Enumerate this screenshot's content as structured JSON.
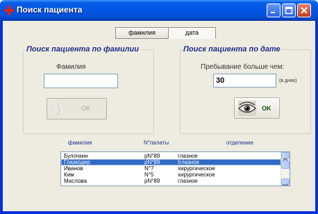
{
  "window": {
    "title": "Поиск пациента"
  },
  "tabs": [
    {
      "label": "фамилия"
    },
    {
      "label": "дата"
    }
  ],
  "by_surname": {
    "legend": "Поиск пациента по фамилии",
    "field_label": "Фамилия",
    "field_value": "",
    "ok_label": "OK"
  },
  "by_date": {
    "legend": "Поиск пациента по дате",
    "field_label": "Пребывание больше чем:",
    "days_value": "30",
    "unit_label": "(в днях)",
    "ok_label": "OK"
  },
  "columns": {
    "surname": "фамилия",
    "ward": "N°палаты",
    "department": "отделение"
  },
  "patients": [
    {
      "surname": "Булочкин",
      "ward": "pN°89",
      "department": "глазное"
    },
    {
      "surname": "Глазкодер",
      "ward": "pN°89",
      "department": "Iглазное",
      "selected": true
    },
    {
      "surname": "Иванов",
      "ward": "N°7",
      "department": "хирургическое"
    },
    {
      "surname": "Ким",
      "ward": "N°5",
      "department": "хирургическое"
    },
    {
      "surname": "Маслова",
      "ward": "pN°89",
      "department": "глазное"
    }
  ],
  "colors": {
    "title_bar": "#0054e3",
    "legend": "#1f2f88",
    "selection": "#316ac5"
  }
}
